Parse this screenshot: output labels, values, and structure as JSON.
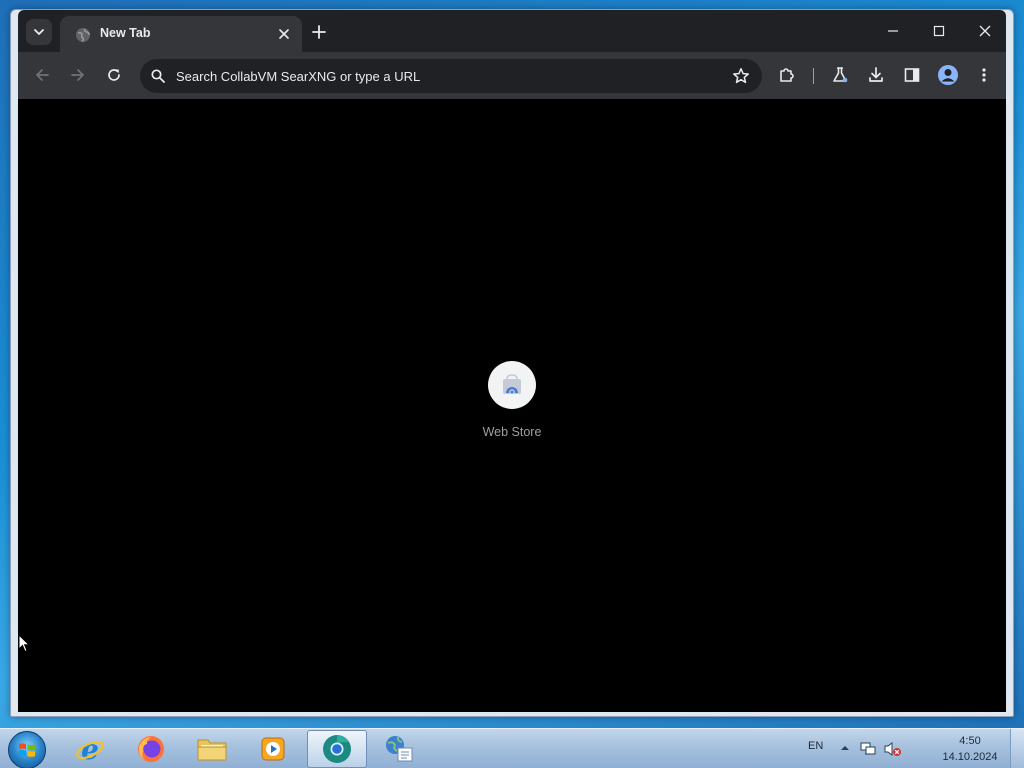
{
  "browser": {
    "tab": {
      "title": "New Tab"
    },
    "omnibox": {
      "placeholder": "Search CollabVM SearXNG or type a URL"
    },
    "accent_color": "#8ab4f8"
  },
  "new_tab_page": {
    "shortcuts": [
      {
        "label": "Web Store",
        "icon": "webstore-icon"
      }
    ]
  },
  "taskbar": {
    "apps": [
      {
        "name": "internet-explorer",
        "icon": "ie-icon"
      },
      {
        "name": "firefox",
        "icon": "firefox-icon"
      },
      {
        "name": "file-explorer",
        "icon": "folder-icon"
      },
      {
        "name": "media-player",
        "icon": "media-player-icon"
      },
      {
        "name": "chromium",
        "icon": "chromium-icon",
        "active": true
      },
      {
        "name": "network-app",
        "icon": "network-app-icon"
      }
    ],
    "tray": {
      "language": "EN",
      "time": "4:50",
      "date": "14.10.2024"
    }
  }
}
